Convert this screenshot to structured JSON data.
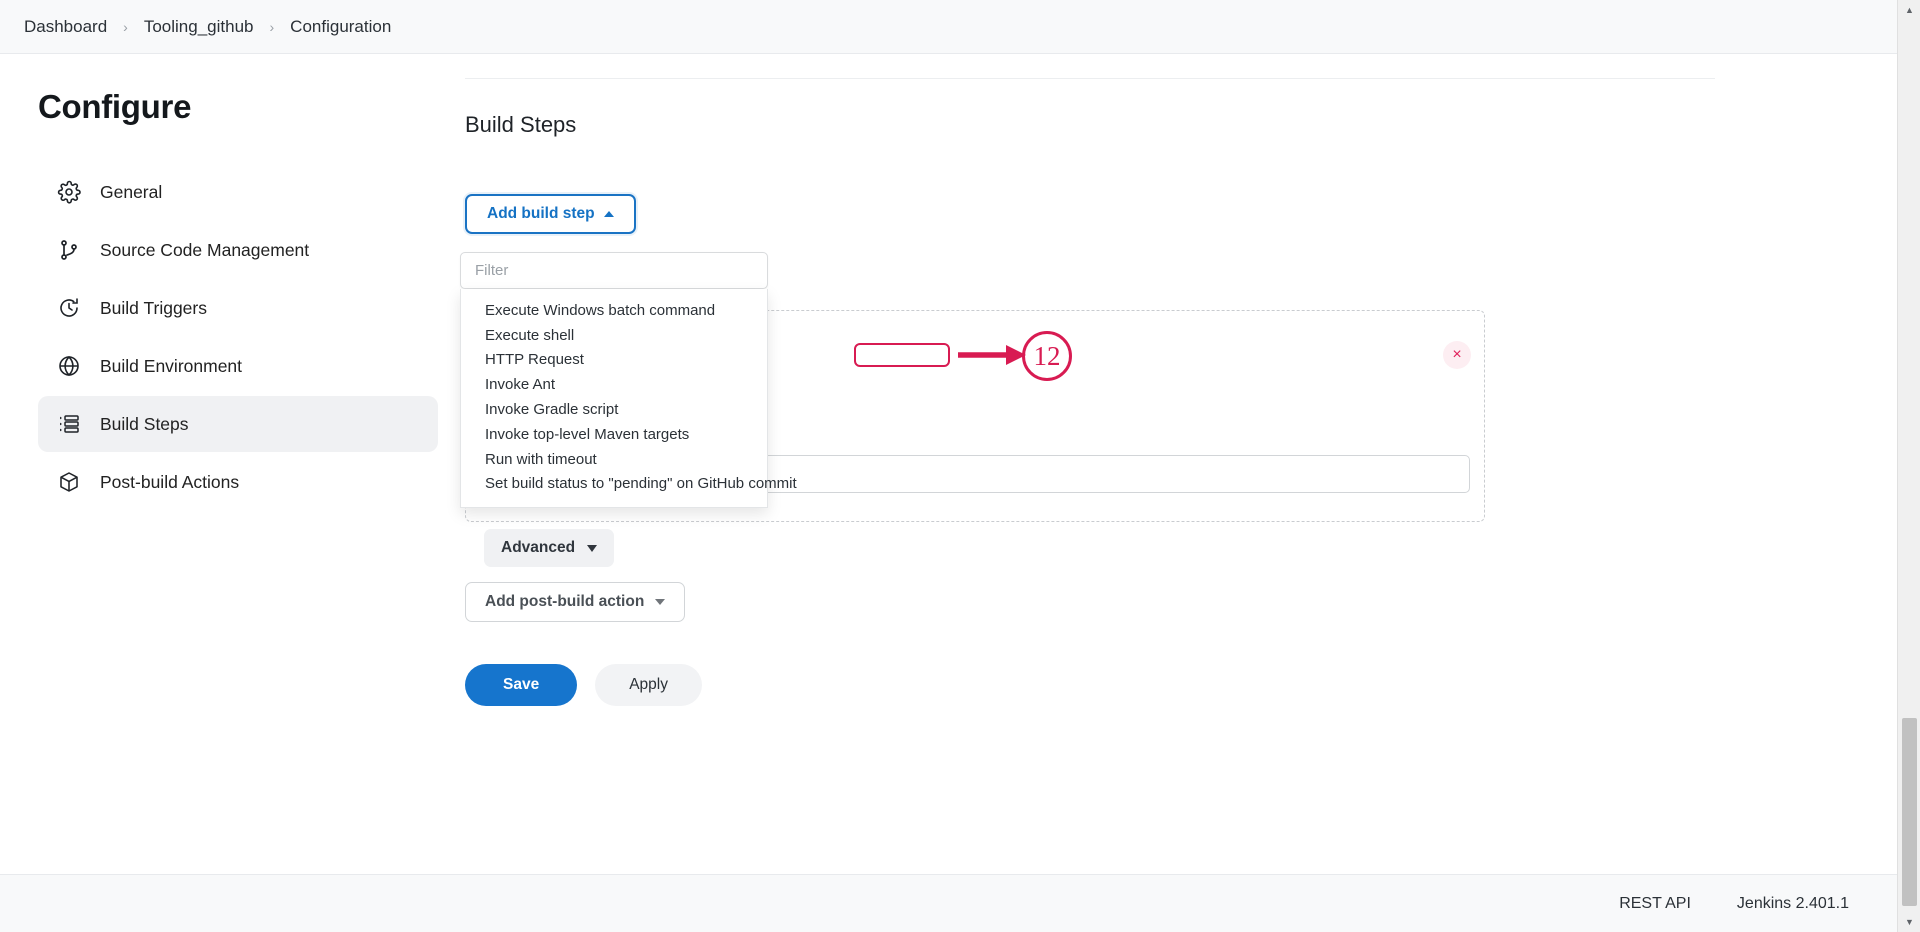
{
  "breadcrumb": {
    "items": [
      {
        "label": "Dashboard"
      },
      {
        "label": "Tooling_github"
      },
      {
        "label": "Configuration"
      }
    ],
    "separator": "›"
  },
  "sidebar": {
    "title": "Configure",
    "items": [
      {
        "label": "General",
        "icon": "gear-icon"
      },
      {
        "label": "Source Code Management",
        "icon": "git-branch-icon"
      },
      {
        "label": "Build Triggers",
        "icon": "clock-icon"
      },
      {
        "label": "Build Environment",
        "icon": "globe-icon"
      },
      {
        "label": "Build Steps",
        "icon": "list-steps-icon"
      },
      {
        "label": "Post-build Actions",
        "icon": "package-icon"
      }
    ],
    "selected": "Build Steps"
  },
  "main": {
    "section_title": "Build Steps",
    "add_build_step_label": "Add build step",
    "add_post_build_action_label": "Add post-build action",
    "advanced_label": "Advanced",
    "save_label": "Save",
    "apply_label": "Apply",
    "close_glyph": "×",
    "panel_input_value": ""
  },
  "dropdown": {
    "filter_placeholder": "Filter",
    "filter_value": "",
    "items": [
      {
        "label": "Execute Windows batch command"
      },
      {
        "label": "Execute shell"
      },
      {
        "label": "HTTP Request"
      },
      {
        "label": "Invoke Ant"
      },
      {
        "label": "Invoke Gradle script"
      },
      {
        "label": "Invoke top-level Maven targets"
      },
      {
        "label": "Run with timeout"
      },
      {
        "label": "Set build status to \"pending\" on GitHub commit"
      }
    ],
    "highlighted": "HTTP Request"
  },
  "annotation": {
    "step_number": "12",
    "color": "#d81b52",
    "target": "HTTP Request"
  },
  "footer": {
    "rest_api_label": "REST API",
    "version_label": "Jenkins 2.401.1"
  },
  "colors": {
    "accent_blue": "#1675cd",
    "annotation_crimson": "#d81b52",
    "close_red": "#e01e5a",
    "selected_bg": "#f0f1f3"
  }
}
